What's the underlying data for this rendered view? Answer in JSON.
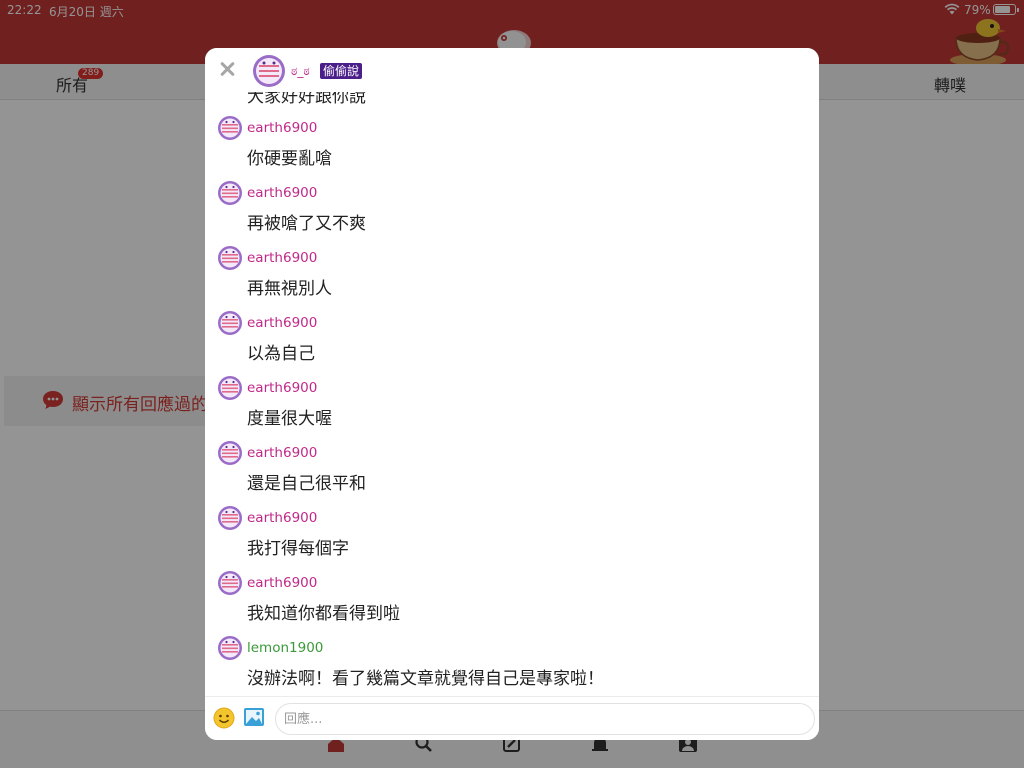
{
  "status_bar": {
    "time": "22:22",
    "date": "6月20日 週六",
    "battery": "79%",
    "battery_level": 0.79
  },
  "tabs": {
    "all_label": "所有",
    "all_badge": "289",
    "repost_label": "轉噗"
  },
  "notice": {
    "text": "顯示所有回應過的"
  },
  "modal": {
    "header": {
      "name": "ಠ_ಠ",
      "tag": "偷偷說"
    },
    "partial_text": "大家好好跟你說",
    "messages": [
      {
        "user": "earth6900",
        "text": "你硬要亂嗆",
        "user_color": "#c0298a"
      },
      {
        "user": "earth6900",
        "text": "再被嗆了又不爽",
        "user_color": "#c0298a"
      },
      {
        "user": "earth6900",
        "text": "再無視別人",
        "user_color": "#c0298a"
      },
      {
        "user": "earth6900",
        "text": "以為自己",
        "user_color": "#c0298a"
      },
      {
        "user": "earth6900",
        "text": "度量很大喔",
        "user_color": "#c0298a"
      },
      {
        "user": "earth6900",
        "text": "還是自己很平和",
        "user_color": "#c0298a"
      },
      {
        "user": "earth6900",
        "text": "我打得每個字",
        "user_color": "#c0298a"
      },
      {
        "user": "earth6900",
        "text": "我知道你都看得到啦",
        "user_color": "#c0298a"
      },
      {
        "user": "lemon1900",
        "text": "沒辦法啊！看了幾篇文章就覺得自己是專家啦！",
        "user_color": "#3a9a3a"
      }
    ],
    "input": {
      "placeholder": "回應..."
    }
  },
  "colors": {
    "brand_red": "#c23a36",
    "header_tag_bg": "#4b1f8a",
    "badge": "#e0322f"
  },
  "icons": [
    "close-icon",
    "emoji-icon",
    "image-icon",
    "chat-bubble-icon",
    "wifi-icon",
    "battery-icon",
    "home-icon",
    "search-icon",
    "edit-icon",
    "bell-icon",
    "profile-icon"
  ]
}
